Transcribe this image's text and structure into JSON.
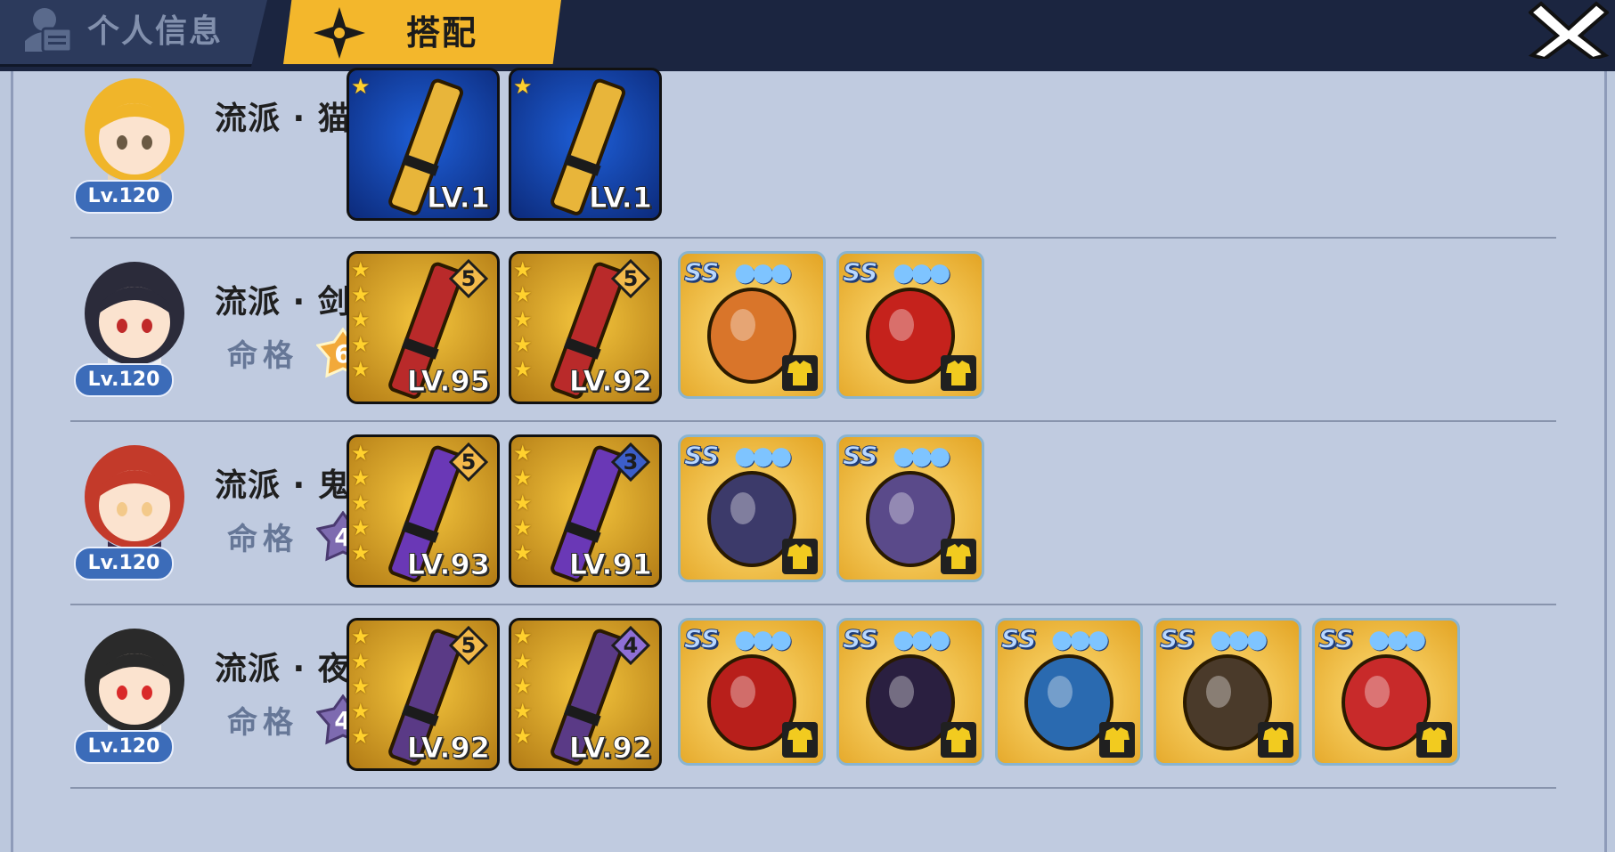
{
  "tabs": {
    "profile": "个人信息",
    "loadout": "搭配"
  },
  "characters": [
    {
      "school": "流派 · 猫太",
      "level": "Lv.120",
      "fate_label": "",
      "fate_value": "",
      "weapons": [
        {
          "level": "LV.1",
          "stars": 1,
          "rank": ""
        },
        {
          "level": "LV.1",
          "stars": 1,
          "rank": ""
        }
      ],
      "equipment": []
    },
    {
      "school": "流派 · 剑心",
      "level": "Lv.120",
      "fate_label": "命格",
      "fate_value": "6",
      "weapons": [
        {
          "level": "LV.95",
          "stars": 5,
          "rank": "5"
        },
        {
          "level": "LV.92",
          "stars": 5,
          "rank": "5"
        }
      ],
      "equipment": [
        {
          "grade": "SS",
          "name": "sword-icon"
        },
        {
          "grade": "SS",
          "name": "fire-gem-icon"
        }
      ]
    },
    {
      "school": "流派 · 鬼斩",
      "level": "Lv.120",
      "fate_label": "命格",
      "fate_value": "4",
      "weapons": [
        {
          "level": "LV.93",
          "stars": 5,
          "rank": "5"
        },
        {
          "level": "LV.91",
          "stars": 5,
          "rank": "3"
        }
      ],
      "equipment": [
        {
          "grade": "SS",
          "name": "vest-icon"
        },
        {
          "grade": "SS",
          "name": "book-icon"
        }
      ]
    },
    {
      "school": "流派 · 夜叉",
      "level": "Lv.120",
      "fate_label": "命格",
      "fate_value": "4",
      "weapons": [
        {
          "level": "LV.92",
          "stars": 5,
          "rank": "5"
        },
        {
          "level": "LV.92",
          "stars": 5,
          "rank": "4"
        }
      ],
      "equipment": [
        {
          "grade": "SS",
          "name": "helmet-icon"
        },
        {
          "grade": "SS",
          "name": "ring-icon"
        },
        {
          "grade": "SS",
          "name": "armor-icon"
        },
        {
          "grade": "SS",
          "name": "gauntlet-icon"
        },
        {
          "grade": "SS",
          "name": "charm-icon"
        }
      ]
    }
  ]
}
